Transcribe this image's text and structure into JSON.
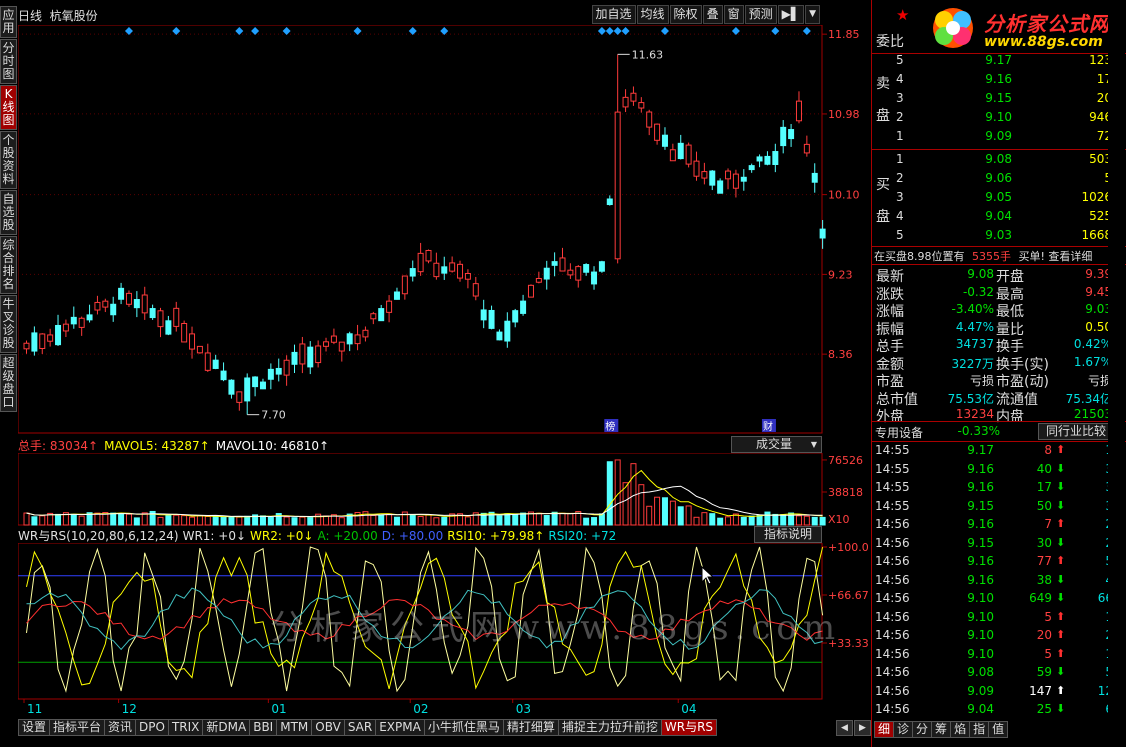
{
  "left_tabs": [
    {
      "label": "应用",
      "active": false
    },
    {
      "label": "分时图",
      "active": false
    },
    {
      "label": "K线图",
      "active": true
    },
    {
      "label": "个股资料",
      "active": false
    },
    {
      "label": "自选股",
      "active": false
    },
    {
      "label": "综合排名",
      "active": false
    },
    {
      "label": "牛叉诊股",
      "active": false
    },
    {
      "label": "超级盘口",
      "active": false
    }
  ],
  "top": {
    "title": "日线  杭氧股份",
    "buttons": [
      "加自选",
      "均线",
      "除权",
      "叠",
      "窗",
      "预测"
    ]
  },
  "main_chart": {
    "price_labels": [
      "11.85",
      "10.98",
      "10.10",
      "9.23",
      "8.36"
    ],
    "high_label": "11.63",
    "low_label": "7.70",
    "badges": [
      "榜",
      "财"
    ]
  },
  "volume": {
    "header": [
      {
        "text": "总手: 83034↑",
        "color": "#ff4040"
      },
      {
        "text": "MAVOL5: 43287↑",
        "color": "#ffff00"
      },
      {
        "text": "MAVOL10: 46810↑",
        "color": "#ffffff"
      }
    ],
    "select": "成交量",
    "labels": [
      "76526",
      "38818",
      "X10"
    ]
  },
  "indicator": {
    "header": [
      {
        "text": "WR与RS(10,20,80,6,12,24)",
        "color": "#e0e0e0"
      },
      {
        "text": "WR1: +0↓",
        "color": "#e0e0e0"
      },
      {
        "text": "WR2: +0↓",
        "color": "#ffff00"
      },
      {
        "text": "A: +20.00",
        "color": "#00c000"
      },
      {
        "text": "D: +80.00",
        "color": "#4060ff"
      },
      {
        "text": "RSI10: +79.98↑",
        "color": "#ffff00"
      },
      {
        "text": "RSI20: +72",
        "color": "#00e0e0"
      }
    ],
    "button": "指标说明",
    "labels": [
      "+100.0",
      "+66.67",
      "+33.33"
    ]
  },
  "x_axis": [
    "11",
    "12",
    "01",
    "02",
    "03",
    "04"
  ],
  "watermark": "分析家公式网www.88gs.com",
  "bottom_tabs": [
    {
      "label": "设置",
      "active": false
    },
    {
      "label": "指标平台",
      "active": false
    },
    {
      "label": "资讯",
      "active": false
    },
    {
      "label": "DPO",
      "active": false
    },
    {
      "label": "TRIX",
      "active": false
    },
    {
      "label": "新DMA",
      "active": false
    },
    {
      "label": "BBI",
      "active": false
    },
    {
      "label": "MTM",
      "active": false
    },
    {
      "label": "OBV",
      "active": false
    },
    {
      "label": "SAR",
      "active": false
    },
    {
      "label": "EXPMA",
      "active": false
    },
    {
      "label": "小牛抓住黑马",
      "active": false
    },
    {
      "label": "精打细算",
      "active": false
    },
    {
      "label": "捕捉主力拉升前挖",
      "active": false
    },
    {
      "label": "WR与RS",
      "active": true
    }
  ],
  "logo": {
    "main": "分析家公式网",
    "sub": "www.88gs.com"
  },
  "order_book": {
    "weibi": "委比",
    "sell_label": [
      "卖",
      "盘"
    ],
    "buy_label": [
      "买",
      "盘"
    ],
    "sell": [
      {
        "level": "5",
        "price": "9.17",
        "vol": "123"
      },
      {
        "level": "4",
        "price": "9.16",
        "vol": "17"
      },
      {
        "level": "3",
        "price": "9.15",
        "vol": "20"
      },
      {
        "level": "2",
        "price": "9.10",
        "vol": "946"
      },
      {
        "level": "1",
        "price": "9.09",
        "vol": "72"
      }
    ],
    "buy": [
      {
        "level": "1",
        "price": "9.08",
        "vol": "503"
      },
      {
        "level": "2",
        "price": "9.06",
        "vol": "5"
      },
      {
        "level": "3",
        "price": "9.05",
        "vol": "1026"
      },
      {
        "level": "4",
        "price": "9.04",
        "vol": "525"
      },
      {
        "level": "5",
        "price": "9.03",
        "vol": "1668"
      }
    ],
    "in_buy": {
      "a": "在买盘8.98位置有",
      "b": "5355手",
      "c": "买单! 查看详细"
    }
  },
  "quote": [
    {
      "l1": "最新",
      "v1": "9.08",
      "c1": "#00e000",
      "l2": "开盘",
      "v2": "9.39",
      "c2": "#ff4040"
    },
    {
      "l1": "涨跌",
      "v1": "-0.32",
      "c1": "#00e000",
      "l2": "最高",
      "v2": "9.45",
      "c2": "#ff4040"
    },
    {
      "l1": "涨幅",
      "v1": "-3.40%",
      "c1": "#00e000",
      "l2": "最低",
      "v2": "9.03",
      "c2": "#00e000"
    },
    {
      "l1": "振幅",
      "v1": "4.47%",
      "c1": "#00e0e0",
      "l2": "量比",
      "v2": "0.50",
      "c2": "#ffff00"
    },
    {
      "l1": "总手",
      "v1": "34737",
      "c1": "#00e0e0",
      "l2": "换手",
      "v2": "0.42%",
      "c2": "#00e0e0"
    },
    {
      "l1": "金额",
      "v1": "3227万",
      "c1": "#00e0e0",
      "l2": "换手(实)",
      "v2": "1.67%",
      "c2": "#00e0e0"
    },
    {
      "l1": "市盈",
      "v1": "亏损",
      "c1": "#e0e0e0",
      "l2": "市盈(动)",
      "v2": "亏损",
      "c2": "#e0e0e0"
    },
    {
      "l1": "总市值",
      "v1": "75.53亿",
      "c1": "#00e0e0",
      "l2": "流通值",
      "v2": "75.34亿",
      "c2": "#00e0e0"
    },
    {
      "l1": "外盘",
      "v1": "13234",
      "c1": "#ff4040",
      "l2": "内盘",
      "v2": "21503",
      "c2": "#00e000"
    }
  ],
  "sector": {
    "name": "专用设备",
    "pct": "-0.33%",
    "button": "同行业比较"
  },
  "ticks": [
    {
      "time": "14:55",
      "price": "9.17",
      "vol": "8",
      "dir": "up",
      "n": "1"
    },
    {
      "time": "14:55",
      "price": "9.16",
      "vol": "40",
      "dir": "down",
      "n": "3"
    },
    {
      "time": "14:55",
      "price": "9.16",
      "vol": "17",
      "dir": "down",
      "n": "3"
    },
    {
      "time": "14:55",
      "price": "9.15",
      "vol": "50",
      "dir": "down",
      "n": "3"
    },
    {
      "time": "14:56",
      "price": "9.16",
      "vol": "7",
      "dir": "up",
      "n": "2"
    },
    {
      "time": "14:56",
      "price": "9.15",
      "vol": "30",
      "dir": "down",
      "n": "2"
    },
    {
      "time": "14:56",
      "price": "9.16",
      "vol": "77",
      "dir": "up",
      "n": "5"
    },
    {
      "time": "14:56",
      "price": "9.16",
      "vol": "38",
      "dir": "down",
      "n": "4"
    },
    {
      "time": "14:56",
      "price": "9.10",
      "vol": "649",
      "dir": "down",
      "n": "66"
    },
    {
      "time": "14:56",
      "price": "9.10",
      "vol": "5",
      "dir": "up",
      "n": "1"
    },
    {
      "time": "14:56",
      "price": "9.10",
      "vol": "20",
      "dir": "up",
      "n": "2"
    },
    {
      "time": "14:56",
      "price": "9.10",
      "vol": "5",
      "dir": "up",
      "n": "1"
    },
    {
      "time": "14:56",
      "price": "9.08",
      "vol": "59",
      "dir": "down",
      "n": "5"
    },
    {
      "time": "14:56",
      "price": "9.09",
      "vol": "147",
      "dir": "upw",
      "n": "12"
    },
    {
      "time": "14:56",
      "price": "9.04",
      "vol": "25",
      "dir": "down",
      "n": "6"
    }
  ],
  "right_tabs": [
    {
      "label": "细",
      "active": true
    },
    {
      "label": "诊",
      "active": false
    },
    {
      "label": "分",
      "active": false
    },
    {
      "label": "筹",
      "active": false
    },
    {
      "label": "焰",
      "active": false
    },
    {
      "label": "指",
      "active": false
    },
    {
      "label": "值",
      "active": false
    }
  ],
  "colors": {
    "up": "#ff3b3b",
    "down": "#54ffff",
    "axis": "#a00000",
    "grid": "#5a0000"
  }
}
